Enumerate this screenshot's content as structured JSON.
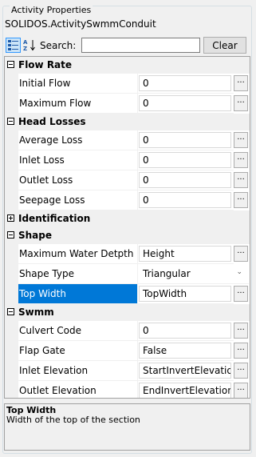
{
  "panel": {
    "title": "Activity Properties",
    "object_name": "SOLIDOS.ActivitySwmmConduit"
  },
  "toolbar": {
    "categorized_icon": "categorized-view-icon",
    "alphabetical_icon": "alphabetical-sort-icon",
    "search_label": "Search:",
    "search_value": "",
    "clear_label": "Clear"
  },
  "colors": {
    "selection": "#0078d7",
    "background": "#f0f0f0",
    "grid_line": "#f0f0f0"
  },
  "grid": {
    "flow_rate": {
      "name": "Flow Rate",
      "expanded": true,
      "props": [
        {
          "name": "Initial Flow",
          "value": "0",
          "editor": "..."
        },
        {
          "name": "Maximum Flow",
          "value": "0",
          "editor": "..."
        }
      ]
    },
    "head_losses": {
      "name": "Head Losses",
      "expanded": true,
      "props": [
        {
          "name": "Average Loss",
          "value": "0",
          "editor": "..."
        },
        {
          "name": "Inlet Loss",
          "value": "0",
          "editor": "..."
        },
        {
          "name": "Outlet Loss",
          "value": "0",
          "editor": "..."
        },
        {
          "name": "Seepage Loss",
          "value": "0",
          "editor": "..."
        }
      ]
    },
    "identification": {
      "name": "Identification",
      "expanded": false
    },
    "shape": {
      "name": "Shape",
      "expanded": true,
      "props": [
        {
          "name": "Maximum Water Detpth",
          "value": "Height",
          "editor": "..."
        },
        {
          "name": "Shape Type",
          "value": "Triangular",
          "dropdown_icon": "chevron-down-icon"
        },
        {
          "name": "Top Width",
          "value": "TopWidth",
          "editor": "...",
          "selected": true
        }
      ]
    },
    "swmm": {
      "name": "Swmm",
      "expanded": true,
      "props": [
        {
          "name": "Culvert Code",
          "value": "0",
          "editor": "..."
        },
        {
          "name": "Flap Gate",
          "value": "False",
          "editor": "..."
        },
        {
          "name": "Inlet Elevation",
          "value": "StartInvertElevation",
          "editor": "..."
        },
        {
          "name": "Outlet Elevation",
          "value": "EndInvertElevation",
          "editor": "..."
        }
      ]
    }
  },
  "help": {
    "title": "Top Width",
    "description": "Width of the top of the section"
  }
}
